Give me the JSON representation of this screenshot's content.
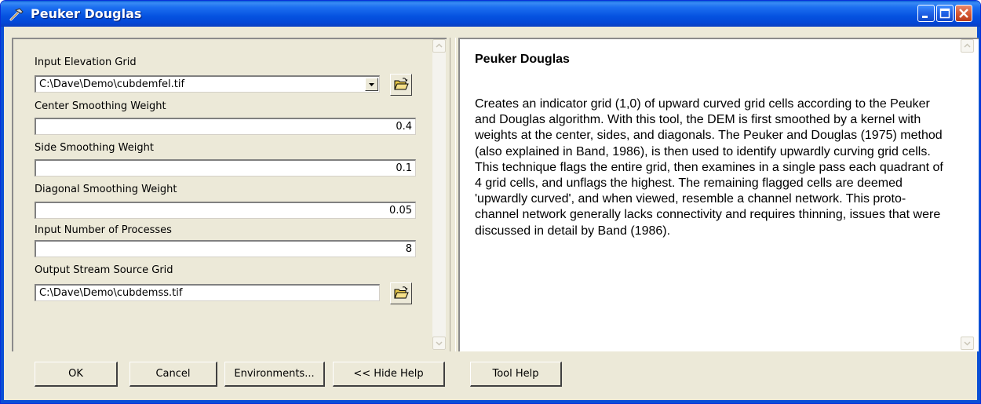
{
  "window": {
    "title": "Peuker Douglas",
    "title_icon": "hammer-icon",
    "controls": [
      "minimize-icon",
      "maximize-icon",
      "close-icon"
    ]
  },
  "form": {
    "input_elevation_grid": {
      "label": "Input Elevation Grid",
      "value": "C:\\Dave\\Demo\\cubdemfel.tif"
    },
    "center_smoothing_weight": {
      "label": "Center Smoothing Weight",
      "value": "0.4"
    },
    "side_smoothing_weight": {
      "label": "Side Smoothing Weight",
      "value": "0.1"
    },
    "diagonal_smoothing_weight": {
      "label": "Diagonal Smoothing Weight",
      "value": "0.05"
    },
    "input_number_of_processes": {
      "label": "Input Number of Processes",
      "value": "8"
    },
    "output_stream_source_grid": {
      "label": "Output Stream Source Grid",
      "value": "C:\\Dave\\Demo\\cubdemss.tif"
    }
  },
  "help": {
    "title": "Peuker Douglas",
    "body": "Creates an indicator grid (1,0) of upward curved grid cells according to the Peuker and Douglas algorithm. With this tool, the DEM is first smoothed by a kernel with weights at the center, sides, and diagonals. The Peuker and Douglas (1975) method (also explained in Band, 1986), is then used to identify upwardly curving grid cells. This technique flags the entire grid, then examines in a single pass each quadrant of 4 grid cells, and unflags the highest. The remaining flagged cells are deemed 'upwardly curved', and when viewed, resemble a channel network. This proto-channel network generally lacks connectivity and requires thinning, issues that were discussed in detail by Band (1986)."
  },
  "buttons": {
    "ok": "OK",
    "cancel": "Cancel",
    "environments": "Environments...",
    "hide_help": "<< Hide Help",
    "tool_help": "Tool Help"
  },
  "colors": {
    "titlebar": "#0552e0",
    "dialog_bg": "#ece9d8",
    "close_button": "#d65b36"
  }
}
